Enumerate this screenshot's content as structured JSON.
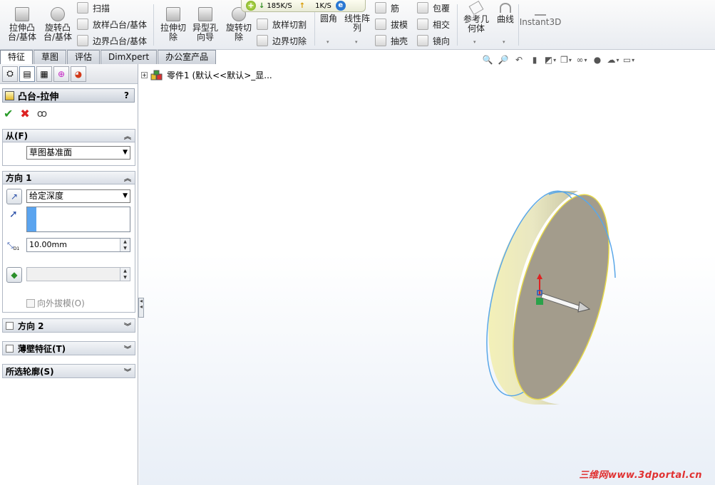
{
  "ribbon": {
    "extrude_boss": "拉伸凸\n台/基体",
    "revolve_boss": "旋转凸\n台/基体",
    "sweep": "扫描",
    "loft_boss": "放样凸台/基体",
    "boundary_boss": "边界凸台/基体",
    "extrude_cut": "拉伸切\n除",
    "hole_wizard": "异型孔\n向导",
    "revolve_cut": "旋转切\n除",
    "loft_cut": "放样切割",
    "boundary_cut": "边界切除",
    "fillet": "圆角",
    "linear_pattern": "线性阵\n列",
    "rib": "筋",
    "draft": "拔模",
    "shell": "抽壳",
    "wrap": "包覆",
    "intersect": "相交",
    "mirror": "镜向",
    "ref_geometry": "参考几\n何体",
    "curves": "曲线",
    "instant3d": "Instant3D"
  },
  "netbar": {
    "down": "185K/S",
    "up": "1K/S"
  },
  "tabs": [
    "特征",
    "草图",
    "评估",
    "DimXpert",
    "办公室产品"
  ],
  "feature": {
    "title": "凸台-拉伸",
    "help": "?",
    "from": {
      "label": "从(F)",
      "value": "草图基准面"
    },
    "dir1": {
      "label": "方向 1",
      "end_condition": "给定深度",
      "depth": "10.00mm",
      "draft_outward": "向外拔模(O)"
    },
    "dir2": {
      "label": "方向 2"
    },
    "thin": {
      "label": "薄壁特征(T)"
    },
    "contours": {
      "label": "所选轮廓(S)"
    }
  },
  "tree": {
    "label": "零件1  (默认<<默认>_显..."
  },
  "watermark": "三维网www.3dportal.cn"
}
